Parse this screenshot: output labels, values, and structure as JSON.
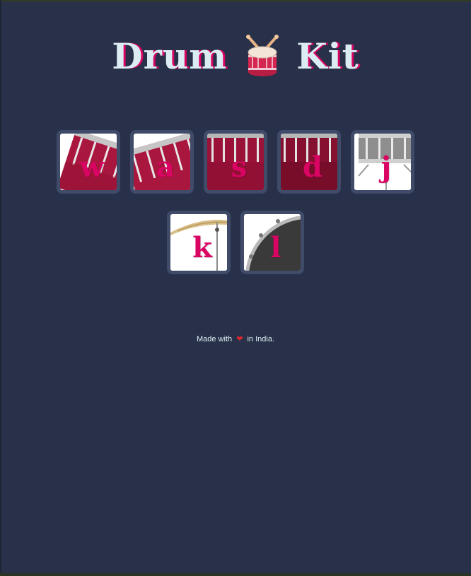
{
  "title": {
    "word1": "Drum",
    "word2": "Kit",
    "icon": "drum-icon"
  },
  "keys": [
    {
      "letter": "w",
      "drum": "tom-1"
    },
    {
      "letter": "a",
      "drum": "tom-2"
    },
    {
      "letter": "s",
      "drum": "tom-3"
    },
    {
      "letter": "d",
      "drum": "tom-4"
    },
    {
      "letter": "j",
      "drum": "snare"
    },
    {
      "letter": "k",
      "drum": "crash"
    },
    {
      "letter": "l",
      "drum": "kick"
    }
  ],
  "footer": {
    "prefix": "Made with",
    "icon": "heart-icon",
    "suffix": "in India."
  },
  "colors": {
    "background": "#283149",
    "border": "#404b69",
    "accent": "#da0463",
    "text": "#dbedf3"
  }
}
